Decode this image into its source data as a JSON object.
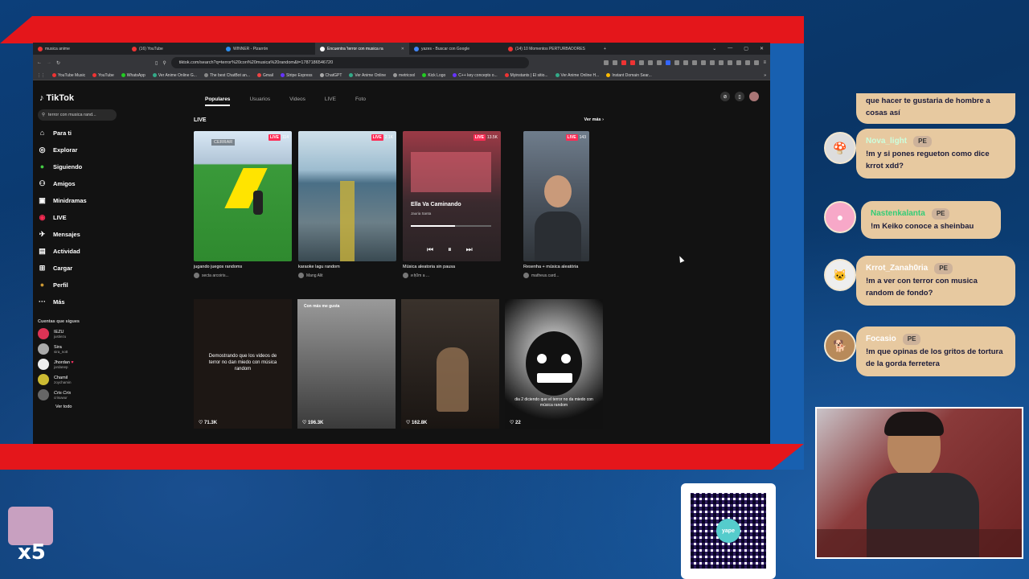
{
  "browser": {
    "tabs": [
      {
        "label": "musica anime",
        "fav": "red"
      },
      {
        "label": "(16) YouTube",
        "fav": "red"
      },
      {
        "label": "WINNER - Pizarrón",
        "fav": "blue"
      },
      {
        "label": "Encuentra 'terror con musica ra",
        "fav": "tiktok",
        "active": true
      },
      {
        "label": "yazes - Buscar con Google",
        "fav": "google"
      },
      {
        "label": "(14) 10 Momentos PERTURBADORES",
        "fav": "red"
      }
    ],
    "url": "tiktok.com/search?q=terror%20con%20musica%20random&t=1787186546720",
    "bookmarks": [
      "YouTube Music",
      "YouTube",
      "WhatsApp",
      "Ver Anime Online G...",
      "The best ChatBot an...",
      "Gmail",
      "Stripe Express",
      "ChatGPT",
      "Ver Anime Online",
      "metricool",
      "Kick Logo",
      "C++ key concepts o...",
      "Myinstants | El sitio...",
      "Ver Anime Online H...",
      "Instant Domain Sear..."
    ]
  },
  "tiktok": {
    "logo": "TikTok",
    "search": "terror con musica rand...",
    "nav": [
      {
        "label": "Para ti",
        "icon": "home-icon",
        "glyph": "⌂"
      },
      {
        "label": "Explorar",
        "icon": "compass-icon",
        "glyph": "◎"
      },
      {
        "label": "Siguiendo",
        "icon": "following-icon",
        "glyph": "●"
      },
      {
        "label": "Amigos",
        "icon": "friends-icon",
        "glyph": "⚇"
      },
      {
        "label": "Minidramas",
        "icon": "drama-icon",
        "glyph": "▣"
      },
      {
        "label": "LIVE",
        "icon": "live-icon",
        "glyph": "◉"
      },
      {
        "label": "Mensajes",
        "icon": "messages-icon",
        "glyph": "✈"
      },
      {
        "label": "Actividad",
        "icon": "activity-icon",
        "glyph": "▤"
      },
      {
        "label": "Cargar",
        "icon": "upload-icon",
        "glyph": "⊞"
      },
      {
        "label": "Perfil",
        "icon": "profile-icon",
        "glyph": "●"
      },
      {
        "label": "Más",
        "icon": "more-icon",
        "glyph": "···"
      }
    ],
    "follow_title": "Cuentas que sigues",
    "following": [
      {
        "name": "IEZU",
        "handle": "justiezu"
      },
      {
        "name": "Sira",
        "handle": "sira_nott"
      },
      {
        "name": "Jhordan",
        "handle": "jordanep"
      },
      {
        "name": "Chamil",
        "handle": "zoychamin"
      },
      {
        "name": "Cris Cris",
        "handle": "crisuwur"
      }
    ],
    "ver_todo": "Ver todo",
    "tabs": [
      "Populares",
      "Usuarios",
      "Videos",
      "LIVE",
      "Foto"
    ],
    "live_heading": "LIVE",
    "ver_mas": "Ver más",
    "live_cards": [
      {
        "title": "jugando juegos randoms",
        "user": "secta arcoiris...",
        "viewers": "114",
        "bg": "linear-gradient(180deg,#d9e8f5 0%,#b0c4d6 25%,#3a9a3a 26%,#2f8a2f 100%)",
        "overlay": "CERRAR"
      },
      {
        "title": "karaoke lagu random",
        "user": "Mang Alit",
        "viewers": "2.1K",
        "bg": "linear-gradient(180deg,#cfe0ea 0%,#9dbccf 30%,#4a6f86 40%,#6b7f88 70%,#3a4a52 100%)"
      },
      {
        "title": "Música aleatoria sin pausa",
        "user": "ᴎ ƚᴉ0m a ...",
        "viewers": "13.5K",
        "bg": "linear-gradient(180deg,#9c3a46 0%,#3a2a2e 55%,#2a2224 100%)",
        "song": "Ella Va Caminando",
        "artist": "Jauria Santa"
      },
      {
        "title": "Resenha + música aleatória",
        "user": "matheus.card...",
        "viewers": "143",
        "bg": "linear-gradient(180deg,#6f7d8c 0%,#4c5560 50%,#2e3338 100%)"
      }
    ],
    "video_cards": [
      {
        "likes": "71.3K",
        "text": "Demostrando que los videos de terror no dan miedo con música random",
        "bg": "#1d1714"
      },
      {
        "likes": "196.3K",
        "tag": "Con más me gusta",
        "bg": "linear-gradient(180deg,#9a9a9a,#3a3a3a)"
      },
      {
        "likes": "162.8K",
        "bg": "linear-gradient(180deg,#3a322c,#1a1512)"
      },
      {
        "likes": "22",
        "text": "dia 2 diciendo que el terror no da miedo con música random",
        "bg": "radial-gradient(circle at 50% 40%,#e8e8e8 0%,#777 40%,#111 75%)"
      }
    ]
  },
  "chat": [
    {
      "user": "",
      "text": "que hacer te gustaria de hombre a cosas así",
      "avatar": "partial"
    },
    {
      "user": "Nova_light",
      "badge": "PE",
      "text": "!m y si pones regueton como dice krrot xdd?",
      "avatar": "mushroom"
    },
    {
      "user": "Nastenkalanta",
      "badge": "PE",
      "text": "!m Keiko conoce a sheinbau",
      "avatar": "kirby"
    },
    {
      "user": "Krrot_Zanah0ria",
      "badge": "PE",
      "text": "!m a ver con terror con musica random de fondo?",
      "avatar": "cat"
    },
    {
      "user": "Focasio",
      "badge": "PE",
      "text": "!m que opinas de los gritos de tortura de la gorda ferretera",
      "avatar": "dog"
    }
  ],
  "overlay": {
    "multiplier": "x5",
    "qr_label": "yape"
  }
}
